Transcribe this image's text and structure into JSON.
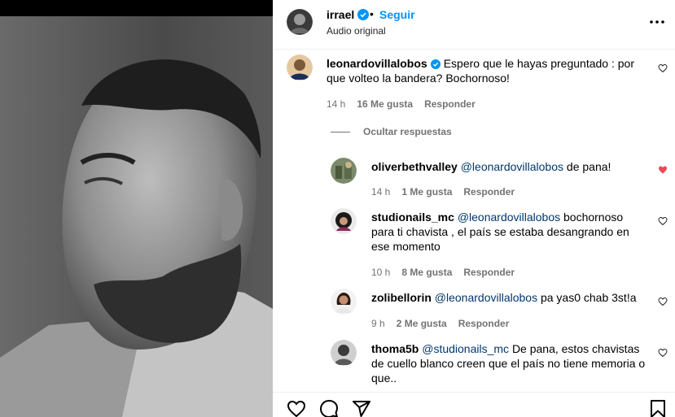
{
  "header": {
    "username": "irrael",
    "separator": "•",
    "follow_label": "Seguir",
    "audio_label": "Audio original"
  },
  "comments": [
    {
      "username": "leonardovillalobos",
      "verified": true,
      "text": "Espero que le hayas preguntado : por que volteo la bandera? Bochornoso!",
      "time": "14 h",
      "likes": "16 Me gusta",
      "reply_label": "Responder",
      "liked": false
    }
  ],
  "hide_replies_label": "Ocultar respuestas",
  "replies": [
    {
      "username": "oliverbethvalley",
      "mention": "@leonardovillalobos",
      "text": "de pana!",
      "time": "14 h",
      "likes": "1 Me gusta",
      "reply_label": "Responder",
      "liked": true
    },
    {
      "username": "studionails_mc",
      "mention": "@leonardovillalobos",
      "text": "bochornoso para ti chavista , el país se estaba desangrando en ese momento",
      "time": "10 h",
      "likes": "8 Me gusta",
      "reply_label": "Responder",
      "liked": false
    },
    {
      "username": "zolibellorin",
      "mention": "@leonardovillalobos",
      "text": "pa yas0 chab 3st!a",
      "time": "9 h",
      "likes": "2 Me gusta",
      "reply_label": "Responder",
      "liked": false
    },
    {
      "username": "thoma5b",
      "mention": "@studionails_mc",
      "text": "De pana, estos chavistas de cuello blanco creen que el país no tiene memoria o que..",
      "liked": false
    }
  ],
  "colors": {
    "accent": "#0095f6",
    "mention": "#00376b",
    "liked_heart": "#ed4956",
    "meta": "#737373"
  },
  "icons": [
    "verified-badge-icon",
    "more-icon",
    "heart-icon",
    "comment-icon",
    "share-icon",
    "bookmark-icon"
  ]
}
